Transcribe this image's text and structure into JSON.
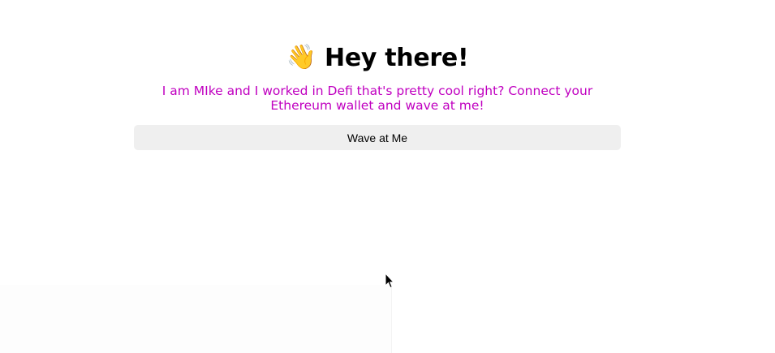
{
  "header": {
    "wave_icon": "waving-hand-icon",
    "wave_glyph": "👋",
    "title": "Hey there!"
  },
  "bio": {
    "text": "I am MIke and I worked in Defi that's pretty cool right? Connect your Ethereum wallet and wave at me!"
  },
  "actions": {
    "wave_label": "Wave at Me"
  },
  "colors": {
    "bio_text": "#c000c0",
    "button_bg": "#efefef",
    "title_text": "#000000"
  },
  "cursor": {
    "icon": "arrow-cursor-icon"
  }
}
